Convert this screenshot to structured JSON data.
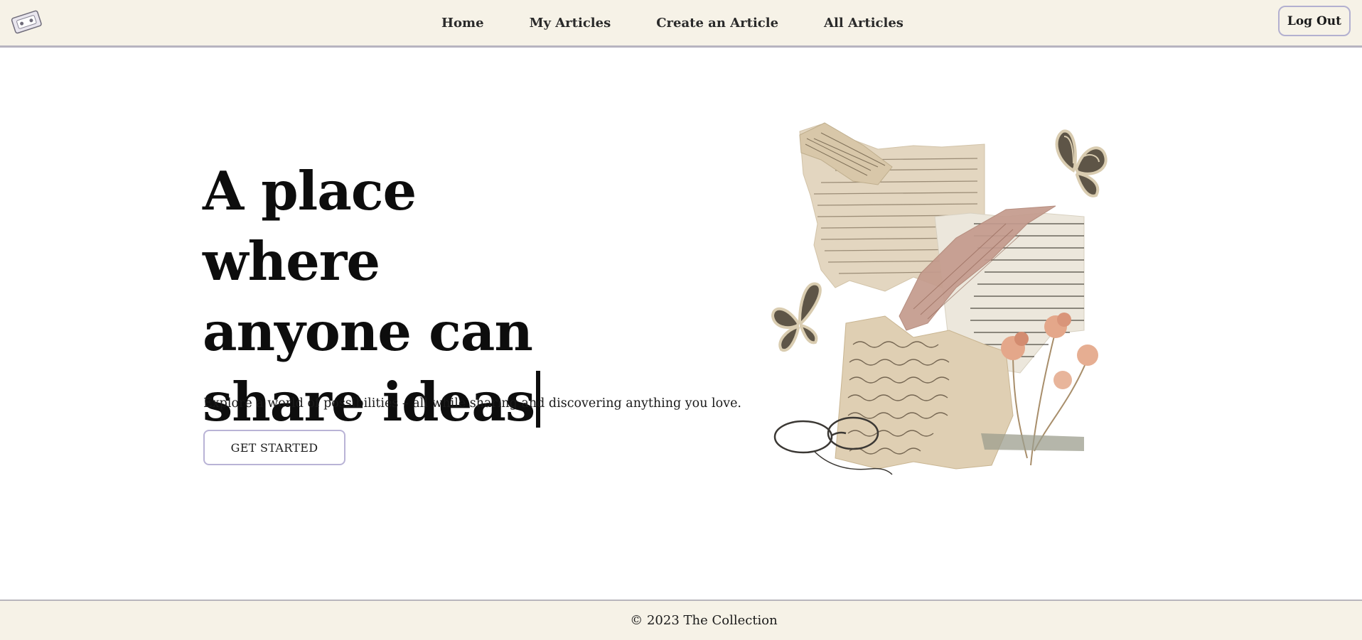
{
  "nav": {
    "links": [
      "Home",
      "My Articles",
      "Create an Article",
      "All Articles"
    ],
    "logout_label": "Log Out"
  },
  "hero": {
    "title_line1": "A place where",
    "title_line2": "anyone can",
    "title_line3": "share ideas",
    "subtitle": "Explore a world of possibilities – all while sharing and discovering anything you love.",
    "cta_label": "GET STARTED"
  },
  "footer": {
    "text": "© 2023 The Collection"
  },
  "colors": {
    "nav_bg": "#f6f2e7",
    "accent_border": "#b9b3d6",
    "text": "#1a1a1a"
  },
  "icons": [
    "logo-icon",
    "text-caret-icon",
    "collage-illustration"
  ]
}
